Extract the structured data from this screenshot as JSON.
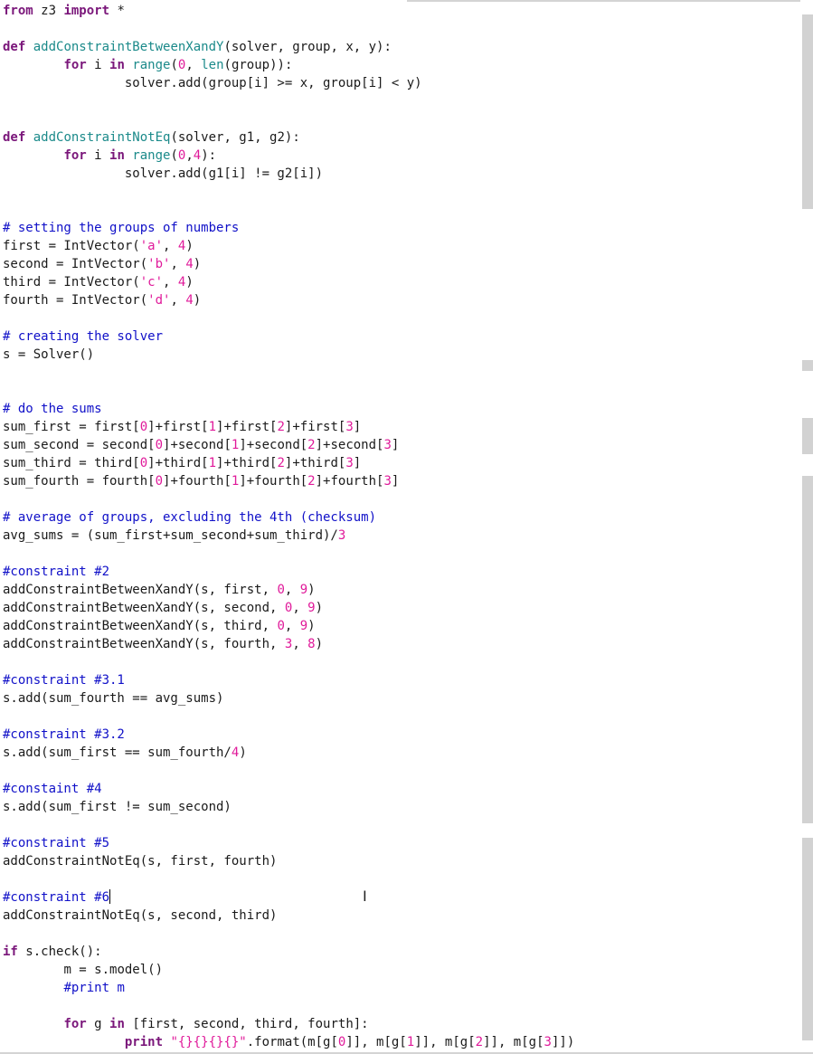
{
  "editor": {
    "lines": [
      [
        {
          "t": "from",
          "c": "kw"
        },
        {
          "t": " z3 "
        },
        {
          "t": "import",
          "c": "kw"
        },
        {
          "t": " *"
        }
      ],
      [],
      [
        {
          "t": "def",
          "c": "kw"
        },
        {
          "t": " "
        },
        {
          "t": "addConstraintBetweenXandY",
          "c": "fn"
        },
        {
          "t": "(solver, group, x, y):"
        }
      ],
      [
        {
          "t": "\t"
        },
        {
          "t": "for",
          "c": "kw"
        },
        {
          "t": " i "
        },
        {
          "t": "in",
          "c": "kw"
        },
        {
          "t": " "
        },
        {
          "t": "range",
          "c": "bi"
        },
        {
          "t": "("
        },
        {
          "t": "0",
          "c": "num"
        },
        {
          "t": ", "
        },
        {
          "t": "len",
          "c": "bi"
        },
        {
          "t": "(group)):"
        }
      ],
      [
        {
          "t": "\t\tsolver.add(group[i] >= x, group[i] < y)"
        }
      ],
      [],
      [],
      [
        {
          "t": "def",
          "c": "kw"
        },
        {
          "t": " "
        },
        {
          "t": "addConstraintNotEq",
          "c": "fn"
        },
        {
          "t": "(solver, g1, g2):"
        }
      ],
      [
        {
          "t": "\t"
        },
        {
          "t": "for",
          "c": "kw"
        },
        {
          "t": " i "
        },
        {
          "t": "in",
          "c": "kw"
        },
        {
          "t": " "
        },
        {
          "t": "range",
          "c": "bi"
        },
        {
          "t": "("
        },
        {
          "t": "0",
          "c": "num"
        },
        {
          "t": ","
        },
        {
          "t": "4",
          "c": "num"
        },
        {
          "t": "):"
        }
      ],
      [
        {
          "t": "\t\tsolver.add(g1[i] != g2[i])"
        }
      ],
      [],
      [],
      [
        {
          "t": "# setting the groups of numbers",
          "c": "cm"
        }
      ],
      [
        {
          "t": "first = IntVector("
        },
        {
          "t": "'a'",
          "c": "str"
        },
        {
          "t": ", "
        },
        {
          "t": "4",
          "c": "num"
        },
        {
          "t": ")"
        }
      ],
      [
        {
          "t": "second = IntVector("
        },
        {
          "t": "'b'",
          "c": "str"
        },
        {
          "t": ", "
        },
        {
          "t": "4",
          "c": "num"
        },
        {
          "t": ")"
        }
      ],
      [
        {
          "t": "third = IntVector("
        },
        {
          "t": "'c'",
          "c": "str"
        },
        {
          "t": ", "
        },
        {
          "t": "4",
          "c": "num"
        },
        {
          "t": ")"
        }
      ],
      [
        {
          "t": "fourth = IntVector("
        },
        {
          "t": "'d'",
          "c": "str"
        },
        {
          "t": ", "
        },
        {
          "t": "4",
          "c": "num"
        },
        {
          "t": ")"
        }
      ],
      [],
      [
        {
          "t": "# creating the solver",
          "c": "cm"
        }
      ],
      [
        {
          "t": "s = Solver()"
        }
      ],
      [],
      [],
      [
        {
          "t": "# do the sums",
          "c": "cm"
        }
      ],
      [
        {
          "t": "sum_first = first["
        },
        {
          "t": "0",
          "c": "num"
        },
        {
          "t": "]+first["
        },
        {
          "t": "1",
          "c": "num"
        },
        {
          "t": "]+first["
        },
        {
          "t": "2",
          "c": "num"
        },
        {
          "t": "]+first["
        },
        {
          "t": "3",
          "c": "num"
        },
        {
          "t": "]"
        }
      ],
      [
        {
          "t": "sum_second = second["
        },
        {
          "t": "0",
          "c": "num"
        },
        {
          "t": "]+second["
        },
        {
          "t": "1",
          "c": "num"
        },
        {
          "t": "]+second["
        },
        {
          "t": "2",
          "c": "num"
        },
        {
          "t": "]+second["
        },
        {
          "t": "3",
          "c": "num"
        },
        {
          "t": "]"
        }
      ],
      [
        {
          "t": "sum_third = third["
        },
        {
          "t": "0",
          "c": "num"
        },
        {
          "t": "]+third["
        },
        {
          "t": "1",
          "c": "num"
        },
        {
          "t": "]+third["
        },
        {
          "t": "2",
          "c": "num"
        },
        {
          "t": "]+third["
        },
        {
          "t": "3",
          "c": "num"
        },
        {
          "t": "]"
        }
      ],
      [
        {
          "t": "sum_fourth = fourth["
        },
        {
          "t": "0",
          "c": "num"
        },
        {
          "t": "]+fourth["
        },
        {
          "t": "1",
          "c": "num"
        },
        {
          "t": "]+fourth["
        },
        {
          "t": "2",
          "c": "num"
        },
        {
          "t": "]+fourth["
        },
        {
          "t": "3",
          "c": "num"
        },
        {
          "t": "]"
        }
      ],
      [],
      [
        {
          "t": "# average of groups, excluding the 4th (checksum)",
          "c": "cm"
        }
      ],
      [
        {
          "t": "avg_sums = (sum_first+sum_second+sum_third)/"
        },
        {
          "t": "3",
          "c": "num"
        }
      ],
      [],
      [
        {
          "t": "#constraint #2",
          "c": "cm"
        }
      ],
      [
        {
          "t": "addConstraintBetweenXandY(s, first, "
        },
        {
          "t": "0",
          "c": "num"
        },
        {
          "t": ", "
        },
        {
          "t": "9",
          "c": "num"
        },
        {
          "t": ")"
        }
      ],
      [
        {
          "t": "addConstraintBetweenXandY(s, second, "
        },
        {
          "t": "0",
          "c": "num"
        },
        {
          "t": ", "
        },
        {
          "t": "9",
          "c": "num"
        },
        {
          "t": ")"
        }
      ],
      [
        {
          "t": "addConstraintBetweenXandY(s, third, "
        },
        {
          "t": "0",
          "c": "num"
        },
        {
          "t": ", "
        },
        {
          "t": "9",
          "c": "num"
        },
        {
          "t": ")"
        }
      ],
      [
        {
          "t": "addConstraintBetweenXandY(s, fourth, "
        },
        {
          "t": "3",
          "c": "num"
        },
        {
          "t": ", "
        },
        {
          "t": "8",
          "c": "num"
        },
        {
          "t": ")"
        }
      ],
      [],
      [
        {
          "t": "#constraint #3.1",
          "c": "cm"
        }
      ],
      [
        {
          "t": "s.add(sum_fourth == avg_sums)"
        }
      ],
      [],
      [
        {
          "t": "#constraint #3.2",
          "c": "cm"
        }
      ],
      [
        {
          "t": "s.add(sum_first == sum_fourth/"
        },
        {
          "t": "4",
          "c": "num"
        },
        {
          "t": ")"
        }
      ],
      [],
      [
        {
          "t": "#constaint #4",
          "c": "cm"
        }
      ],
      [
        {
          "t": "s.add(sum_first != sum_second)"
        }
      ],
      [],
      [
        {
          "t": "#constraint #5",
          "c": "cm"
        }
      ],
      [
        {
          "t": "addConstraintNotEq(s, first, fourth)"
        }
      ],
      [],
      [
        {
          "t": "#constraint #6",
          "c": "cm"
        },
        {
          "cursor": true
        }
      ],
      [
        {
          "t": "addConstraintNotEq(s, second, third)"
        }
      ],
      [],
      [
        {
          "t": "if",
          "c": "kw"
        },
        {
          "t": " s.check():"
        }
      ],
      [
        {
          "t": "\tm = s.model()"
        }
      ],
      [
        {
          "t": "\t"
        },
        {
          "t": "#print m",
          "c": "cm"
        }
      ],
      [],
      [
        {
          "t": "\t"
        },
        {
          "t": "for",
          "c": "kw"
        },
        {
          "t": " g "
        },
        {
          "t": "in",
          "c": "kw"
        },
        {
          "t": " [first, second, third, fourth]:"
        }
      ],
      [
        {
          "t": "\t\t"
        },
        {
          "t": "print",
          "c": "kw"
        },
        {
          "t": " "
        },
        {
          "t": "\"{}{}{}{}\"",
          "c": "str"
        },
        {
          "t": ".format(m[g["
        },
        {
          "t": "0",
          "c": "num"
        },
        {
          "t": "]], m[g["
        },
        {
          "t": "1",
          "c": "num"
        },
        {
          "t": "]], m[g["
        },
        {
          "t": "2",
          "c": "num"
        },
        {
          "t": "]], m[g["
        },
        {
          "t": "3",
          "c": "num"
        },
        {
          "t": "]])"
        }
      ]
    ]
  }
}
